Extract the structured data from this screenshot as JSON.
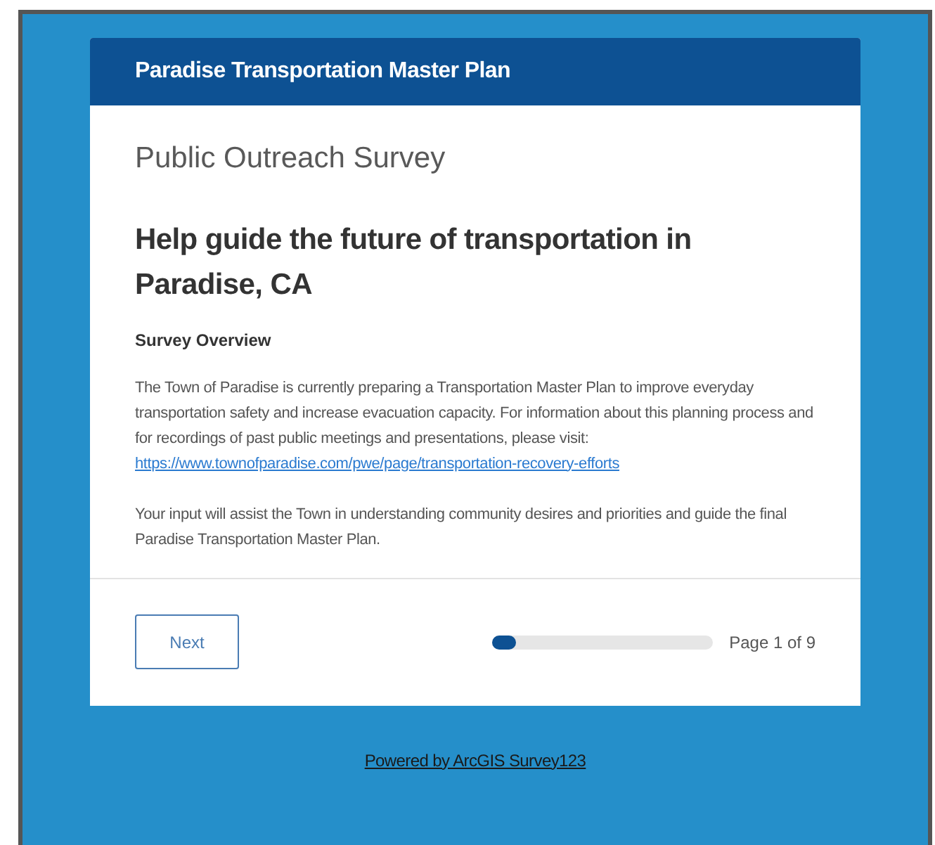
{
  "header": {
    "title": "Paradise Transportation Master Plan"
  },
  "survey_title": "Public Outreach Survey",
  "heading": "Help guide the future of transportation in Paradise, CA",
  "section_title": "Survey Overview",
  "intro": {
    "text": "The Town of Paradise is currently preparing a Transportation Master Plan to improve everyday transportation safety and increase evacuation capacity.  For information about this planning process and for recordings of past public meetings and presentations, please visit:",
    "link": "https://www.townofparadise.com/pwe/page/transportation-recovery-efforts"
  },
  "closing": "Your input will assist the Town in understanding community desires and priorities and guide the final Paradise Transportation Master Plan.",
  "next_button": "Next",
  "progress": {
    "level": 0.11,
    "label": "Page 1 of 9"
  },
  "footer_link": "Powered by ArcGIS Survey123"
}
